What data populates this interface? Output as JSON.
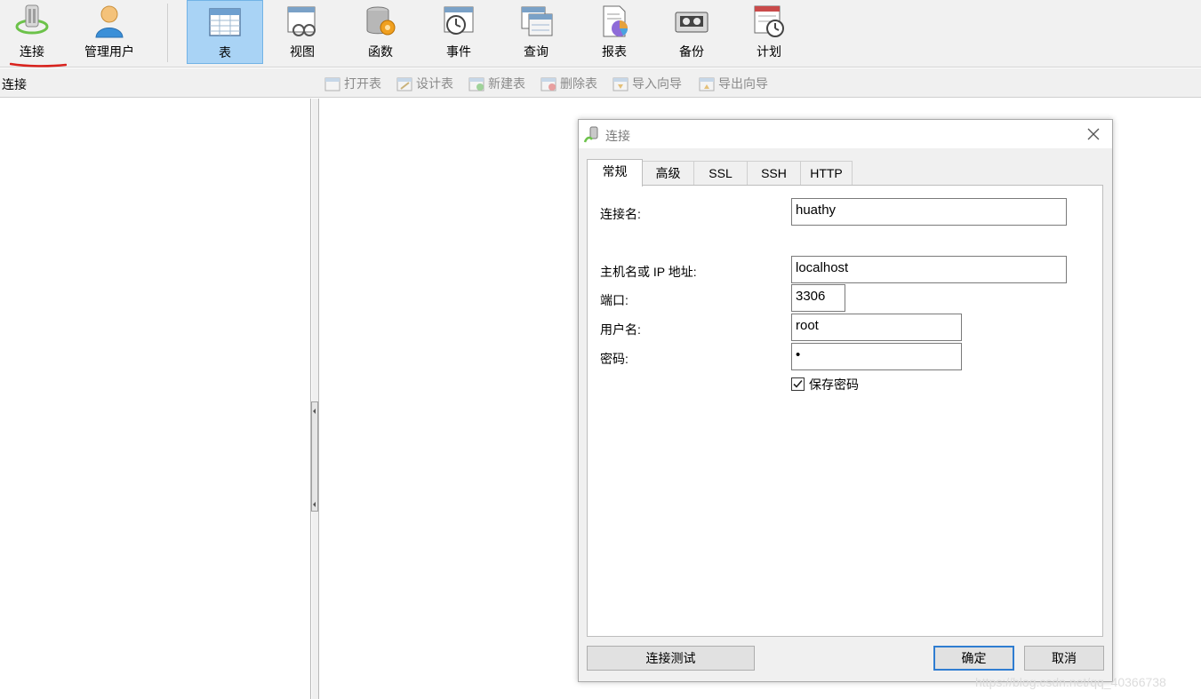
{
  "toolbar": {
    "items": [
      {
        "label": "连接",
        "icon": "connection-plug-icon"
      },
      {
        "label": "管理用户",
        "icon": "user-icon"
      },
      {
        "label": "表",
        "icon": "table-icon",
        "active": true
      },
      {
        "label": "视图",
        "icon": "view-icon"
      },
      {
        "label": "函数",
        "icon": "function-icon"
      },
      {
        "label": "事件",
        "icon": "event-clock-icon"
      },
      {
        "label": "查询",
        "icon": "query-icon"
      },
      {
        "label": "报表",
        "icon": "report-icon"
      },
      {
        "label": "备份",
        "icon": "backup-tape-icon"
      },
      {
        "label": "计划",
        "icon": "schedule-icon"
      }
    ],
    "accent_active": "#a9d3f5"
  },
  "subbar": {
    "title": "连接",
    "actions": [
      "打开表",
      "设计表",
      "新建表",
      "删除表",
      "导入向导",
      "导出向导"
    ]
  },
  "dialog": {
    "title": "连接",
    "tabs": [
      "常规",
      "高级",
      "SSL",
      "SSH",
      "HTTP"
    ],
    "active_tab": "常规",
    "fields": {
      "conn_name_label": "连接名:",
      "conn_name_value": "huathy",
      "host_label": "主机名或 IP 地址:",
      "host_value": "localhost",
      "port_label": "端口:",
      "port_value": "3306",
      "user_label": "用户名:",
      "user_value": "root",
      "password_label": "密码:",
      "password_value": "•"
    },
    "save_password": {
      "label": "保存密码",
      "checked": true
    },
    "buttons": {
      "test": "连接测试",
      "ok": "确定",
      "cancel": "取消"
    }
  },
  "watermark": "https://blog.csdn.net/qq_40366738"
}
